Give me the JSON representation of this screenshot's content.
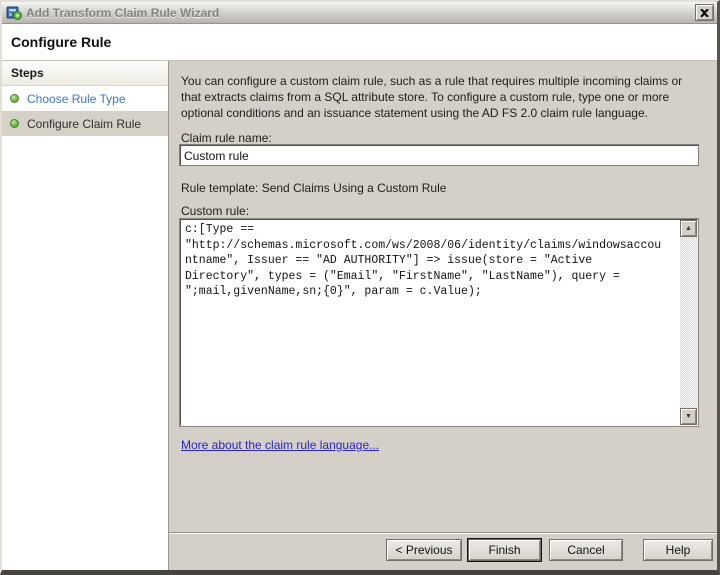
{
  "window": {
    "title": "Add Transform Claim Rule Wizard",
    "icons": {
      "app_icon": "wizard-icon",
      "close_icon": "close-x"
    }
  },
  "header": {
    "title": "Configure Rule"
  },
  "sidebar": {
    "title": "Steps",
    "items": [
      {
        "label": "Choose Rule Type",
        "state": "completed"
      },
      {
        "label": "Configure Claim Rule",
        "state": "current"
      }
    ]
  },
  "content": {
    "description": "You can configure a custom claim rule, such as a rule that requires multiple incoming claims or that extracts claims from a SQL attribute store. To configure a custom rule, type one or more optional conditions and an issuance statement using the AD FS 2.0 claim rule language.",
    "claim_rule_name_label": "Claim rule name:",
    "claim_rule_name_value": "Custom rule",
    "rule_template_text": "Rule template: Send Claims Using a Custom Rule",
    "custom_rule_label": "Custom rule:",
    "custom_rule_value": "c:[Type ==\n\"http://schemas.microsoft.com/ws/2008/06/identity/claims/windowsaccou\nntname\", Issuer == \"AD AUTHORITY\"] => issue(store = \"Active\nDirectory\", types = (\"Email\", \"FirstName\", \"LastName\"), query =\n\";mail,givenName,sn;{0}\", param = c.Value);",
    "link_text": "More about the claim rule language..."
  },
  "scrollbar": {
    "up_glyph": "▲",
    "down_glyph": "▼"
  },
  "buttons": {
    "previous": "< Previous",
    "finish": "Finish",
    "cancel": "Cancel",
    "help": "Help"
  },
  "colors": {
    "panel": "#d4d0c8",
    "sidebar_bg": "#ffffff",
    "step_link_blue": "#3c77c9",
    "bullet_green": "#74b94a",
    "link_blue": "#2a25c9",
    "titlebar_text": "#83817b"
  }
}
